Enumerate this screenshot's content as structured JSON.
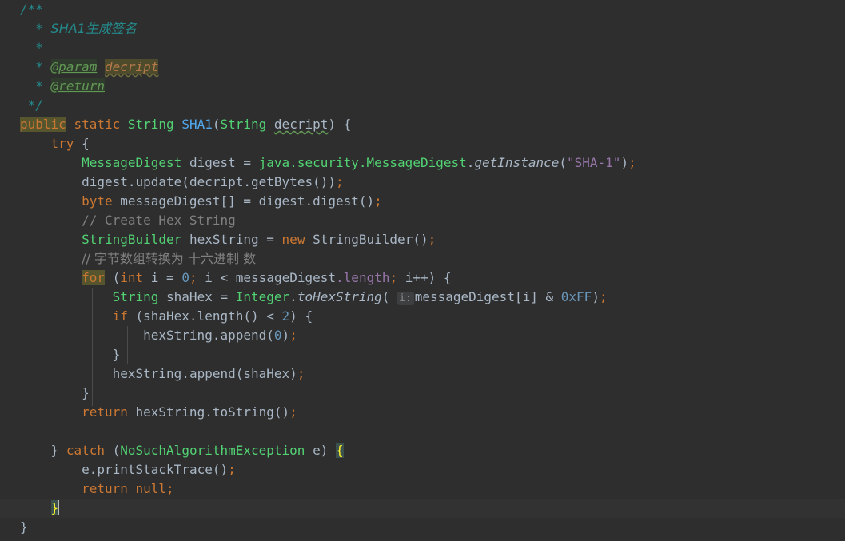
{
  "editor": {
    "language": "java",
    "theme": "darcula",
    "background_color": "#2e2e2e",
    "current_line_color": "#323232",
    "font_size_px": 16,
    "line_height_px": 24,
    "total_lines": 28,
    "caret_line": 27,
    "colors": {
      "default_text": "#a9b7c6",
      "keyword": "#cc7832",
      "type": "#52d273",
      "string": "#9876aa",
      "number": "#6897bb",
      "comment": "#808080",
      "javadoc": "#248a8c",
      "javadoc_tag": "#629755",
      "method_declaration": "#52a8ec",
      "search_highlight_bg": "#56552e",
      "brace_match_bg": "#3b514d",
      "brace_match_fg": "#ffef28",
      "param_hint_bg": "#3d3f41",
      "param_hint_fg": "#868a8c",
      "indent_guide": "#4b4b4b"
    }
  },
  "code": {
    "lines": [
      "/**",
      " * SHA1生成签名",
      " *",
      " * @param decript",
      " * @return",
      " */",
      "public static String SHA1(String decript) {",
      "    try {",
      "        MessageDigest digest = java.security.MessageDigest.getInstance(\"SHA-1\");",
      "        digest.update(decript.getBytes());",
      "        byte messageDigest[] = digest.digest();",
      "        // Create Hex String",
      "        StringBuilder hexString = new StringBuilder();",
      "        // 字节数组转换为 十六进制 数",
      "        for (int i = 0; i < messageDigest.length; i++) {",
      "            String shaHex = Integer.toHexString( i: messageDigest[i] & 0xFF);",
      "            if (shaHex.length() < 2) {",
      "                hexString.append(0);",
      "            }",
      "            hexString.append(shaHex);",
      "        }",
      "        return hexString.toString();",
      "",
      "    } catch (NoSuchAlgorithmException e) {",
      "        e.printStackTrace();",
      "        return null;",
      "    }",
      "}"
    ],
    "tokens": {
      "javadoc_open": "/**",
      "javadoc_star": " *",
      "javadoc_summary": "SHA1生成签名",
      "javadoc_tag_param": "@param",
      "javadoc_tag_param_value": "decript",
      "javadoc_tag_return": "@return",
      "javadoc_close": " */",
      "kw_public": "public",
      "kw_static": "static",
      "kw_try": "try",
      "kw_byte": "byte",
      "kw_new": "new",
      "kw_for": "for",
      "kw_int": "int",
      "kw_if": "if",
      "kw_return": "return",
      "kw_catch": "catch",
      "kw_null": "null",
      "type_String": "String",
      "type_MessageDigest": "MessageDigest",
      "type_StringBuilder": "StringBuilder",
      "type_Integer": "Integer",
      "type_NoSuchAlgorithmException": "NoSuchAlgorithmException",
      "method_name": "SHA1",
      "param_decript": "decript",
      "var_digest": "digest",
      "var_messageDigest": "messageDigest",
      "var_hexString": "hexString",
      "var_shaHex": "shaHex",
      "var_i": "i",
      "var_e": "e",
      "call_getInstance": "getInstance",
      "call_toHexString": "toHexString",
      "call_update": "update",
      "call_getBytes": "getBytes",
      "call_digest": "digest",
      "call_append": "append",
      "call_length": "length",
      "call_toString": "toString",
      "call_printStackTrace": "printStackTrace",
      "field_length": "length",
      "pkg_java": "java",
      "pkg_security": "security",
      "str_sha1": "\"SHA-1\"",
      "num_0": "0",
      "num_2": "2",
      "num_0xFF": "0xFF",
      "comment_create_hex": "// Create Hex String",
      "comment_chinese": "// 字节数组转换为 十六进制 数",
      "param_hint_i": "i:"
    }
  },
  "highlights": {
    "search_term_occurrences": [
      "public",
      "for"
    ],
    "brace_match": [
      "{",
      "}"
    ],
    "typo_words": [
      "decript"
    ]
  }
}
